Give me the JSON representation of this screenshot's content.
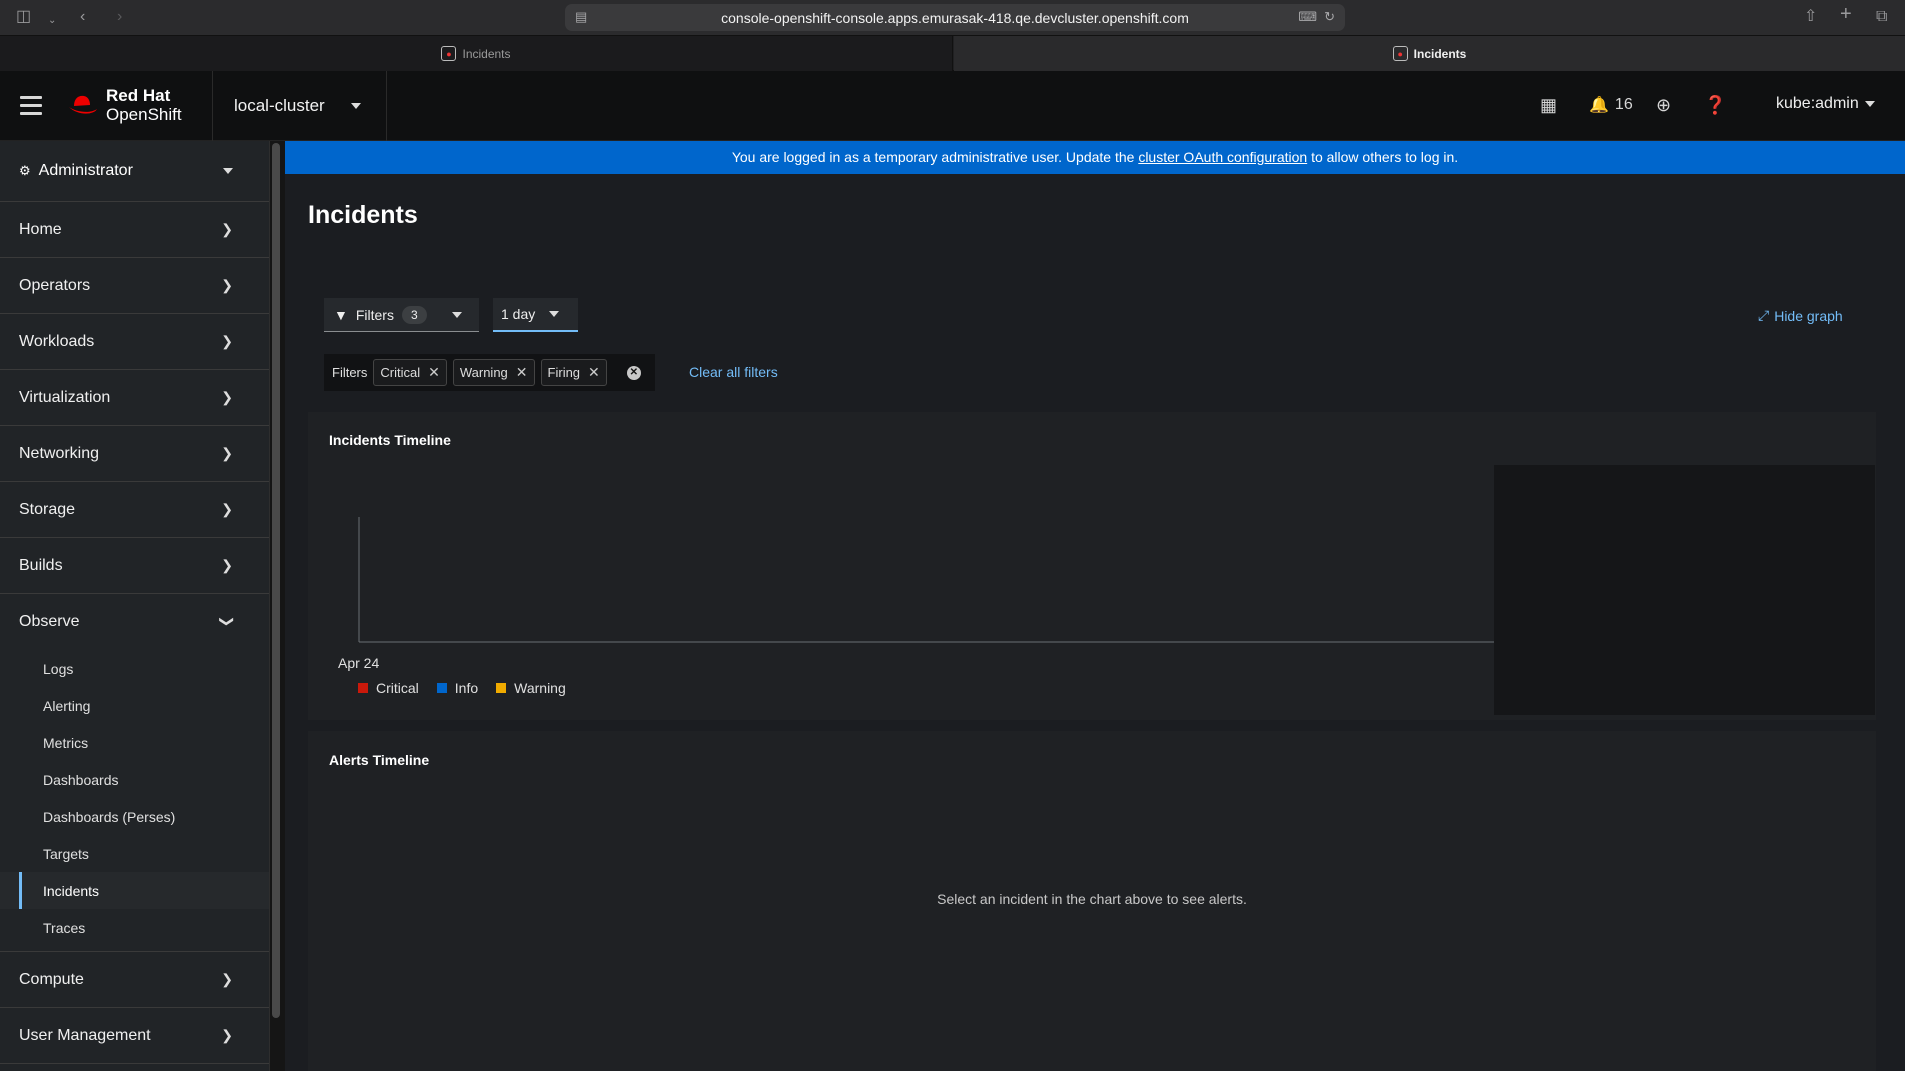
{
  "browser": {
    "url": "console-openshift-console.apps.emurasak-418.qe.devcluster.openshift.com",
    "tabs": [
      {
        "label": "Incidents"
      },
      {
        "label": "Incidents"
      }
    ]
  },
  "masthead": {
    "brand_line1": "Red Hat",
    "brand_line2": "OpenShift",
    "cluster": "local-cluster",
    "notifications_count": "16",
    "user": "kube:admin"
  },
  "sidebar": {
    "perspective": "Administrator",
    "items": [
      {
        "label": "Home"
      },
      {
        "label": "Operators"
      },
      {
        "label": "Workloads"
      },
      {
        "label": "Virtualization"
      },
      {
        "label": "Networking"
      },
      {
        "label": "Storage"
      },
      {
        "label": "Builds"
      },
      {
        "label": "Observe"
      }
    ],
    "observe_sub": [
      {
        "label": "Logs"
      },
      {
        "label": "Alerting"
      },
      {
        "label": "Metrics"
      },
      {
        "label": "Dashboards"
      },
      {
        "label": "Dashboards (Perses)"
      },
      {
        "label": "Targets"
      },
      {
        "label": "Incidents"
      },
      {
        "label": "Traces"
      }
    ],
    "bottom_items": [
      {
        "label": "Compute"
      },
      {
        "label": "User Management"
      }
    ]
  },
  "banner": {
    "prefix": "You are logged in as a temporary administrative user. Update the ",
    "link": "cluster OAuth configuration",
    "suffix": " to allow others to log in."
  },
  "page": {
    "title": "Incidents",
    "filters_label": "Filters",
    "filters_count": "3",
    "time_range": "1 day",
    "hide_graph": "Hide graph",
    "chip_group_label": "Filters",
    "chips": [
      "Critical",
      "Warning",
      "Firing"
    ],
    "clear_all": "Clear all filters"
  },
  "incidents_timeline": {
    "title": "Incidents Timeline",
    "x_tick": "Apr 24",
    "legend": [
      {
        "label": "Critical",
        "color": "#c9190b"
      },
      {
        "label": "Info",
        "color": "#0066cc"
      },
      {
        "label": "Warning",
        "color": "#f0ab00"
      }
    ]
  },
  "alerts_timeline": {
    "title": "Alerts Timeline",
    "empty_message": "Select an incident in the chart above to see alerts."
  },
  "chart_data": {
    "type": "bar",
    "title": "Incidents Timeline",
    "categories": [
      "Apr 24"
    ],
    "series": [
      {
        "name": "Critical",
        "values": []
      },
      {
        "name": "Info",
        "values": []
      },
      {
        "name": "Warning",
        "values": []
      }
    ]
  }
}
